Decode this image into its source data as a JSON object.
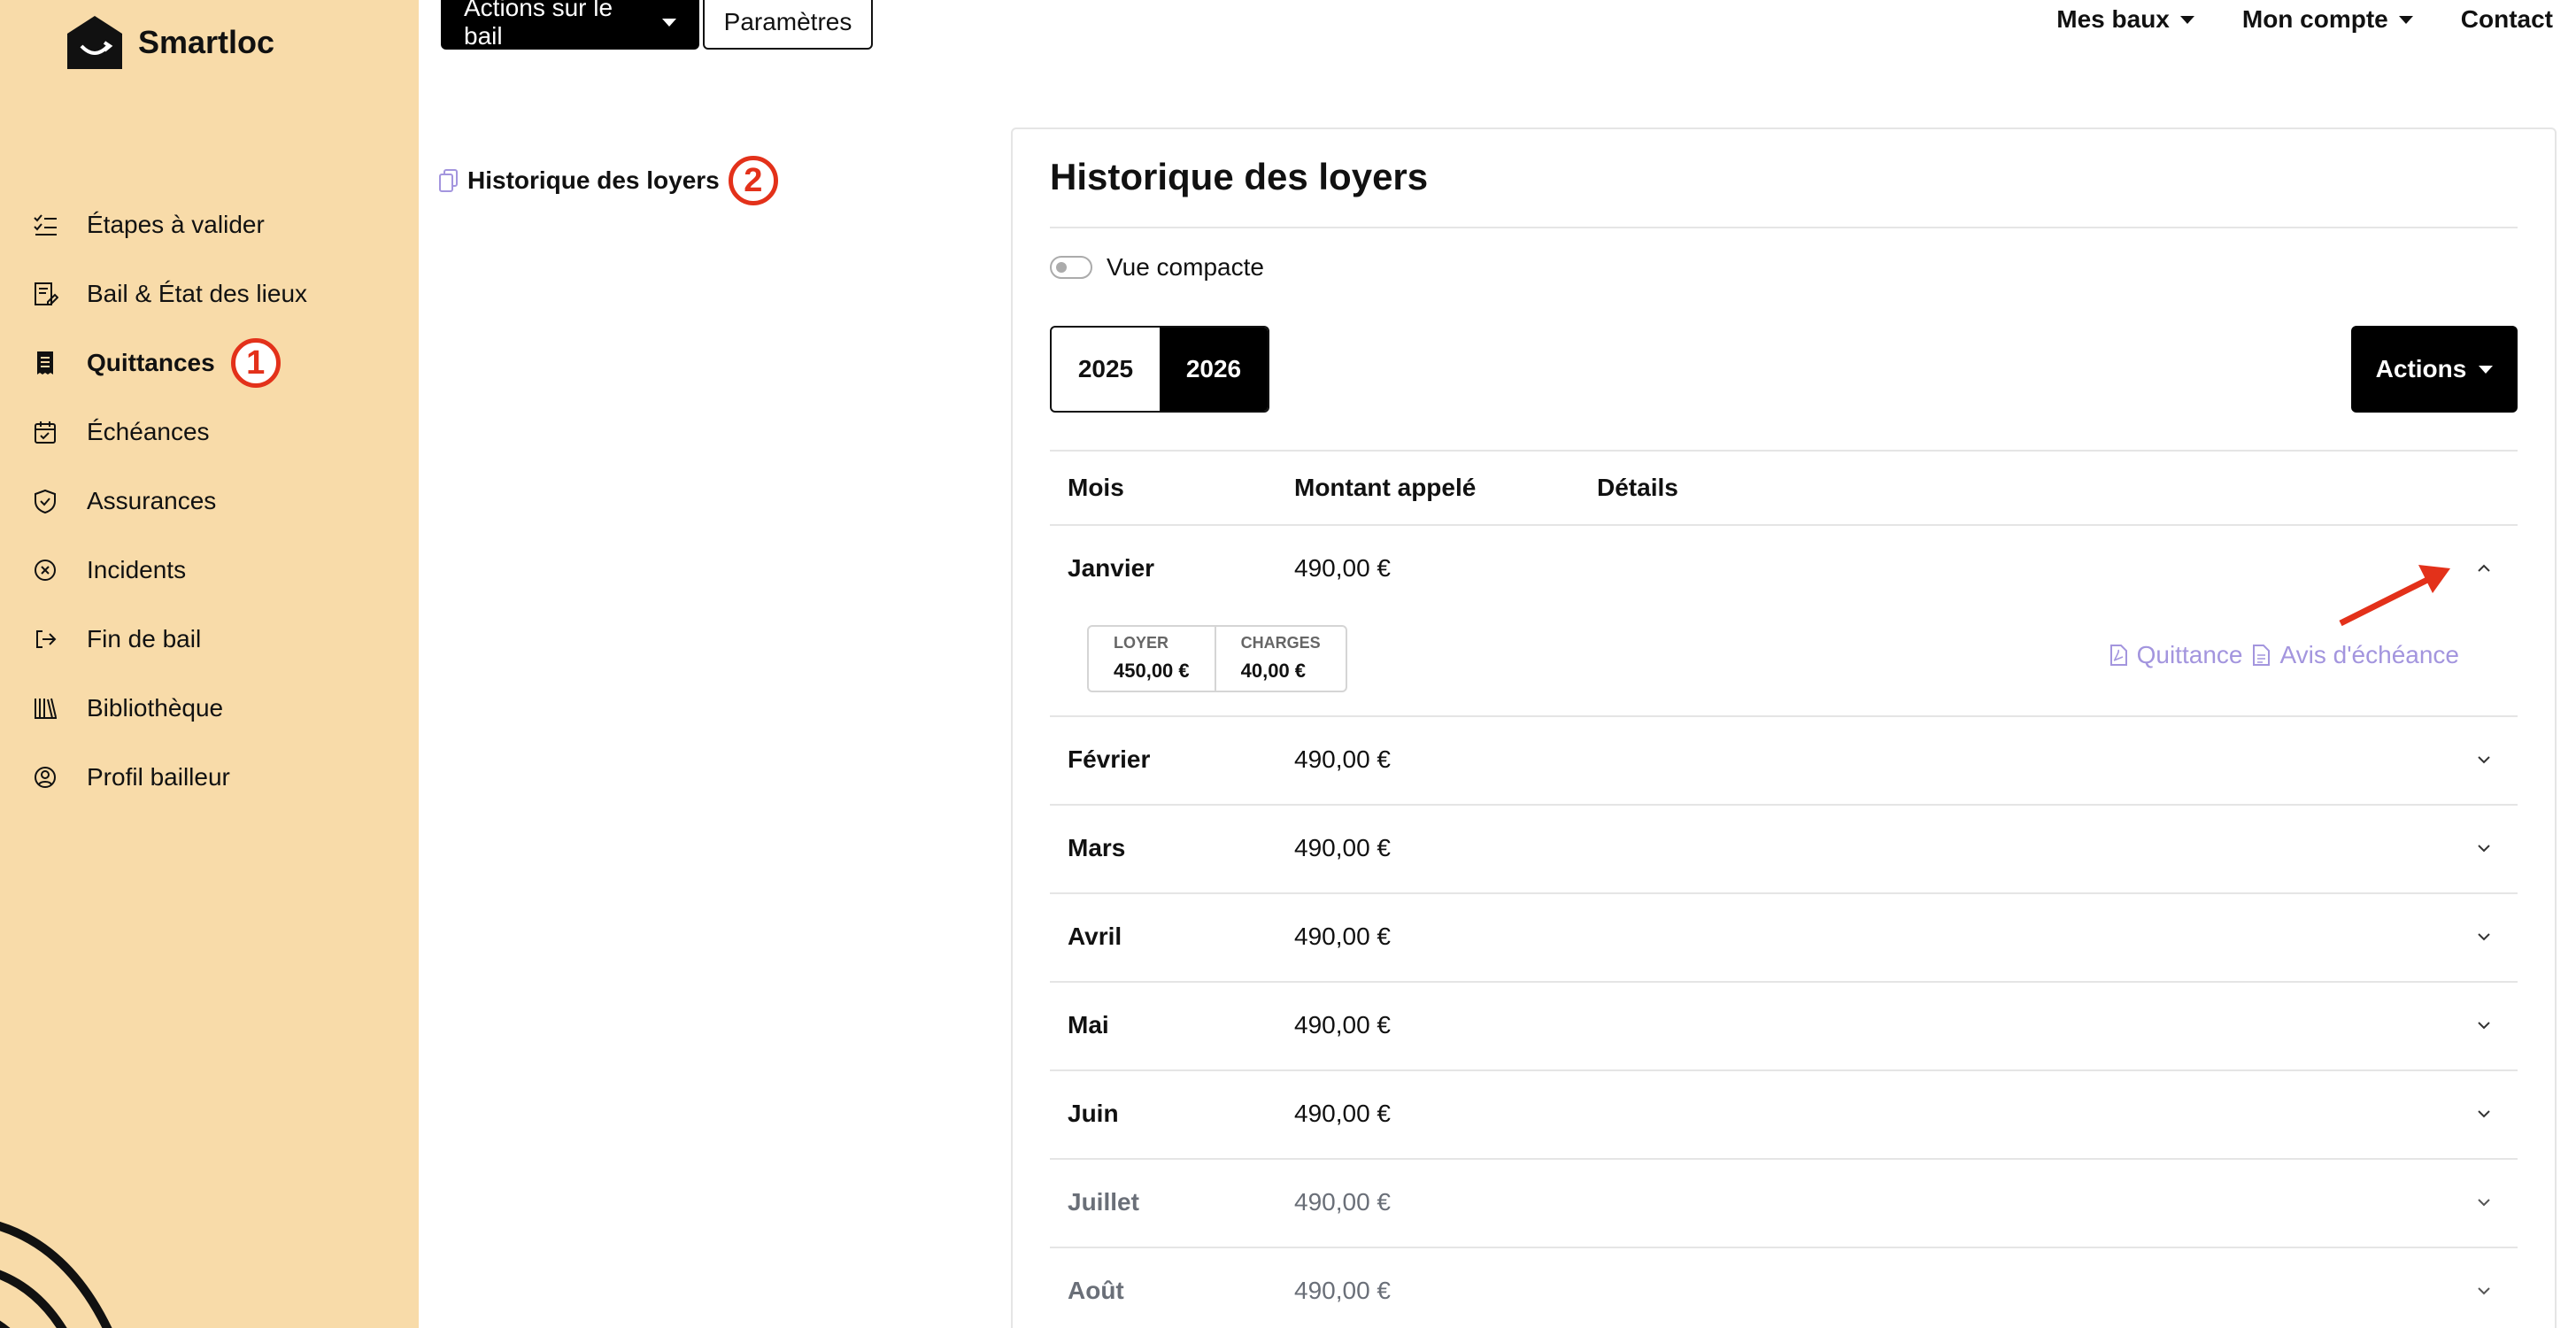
{
  "brand": {
    "name": "Smartloc"
  },
  "sidebar": {
    "items": [
      {
        "label": "Étapes à valider",
        "icon": "checklist-icon"
      },
      {
        "label": "Bail & État des lieux",
        "icon": "edit-document-icon"
      },
      {
        "label": "Quittances",
        "icon": "receipt-icon",
        "active": true
      },
      {
        "label": "Échéances",
        "icon": "calendar-check-icon"
      },
      {
        "label": "Assurances",
        "icon": "shield-icon"
      },
      {
        "label": "Incidents",
        "icon": "close-circle-icon"
      },
      {
        "label": "Fin de bail",
        "icon": "exit-icon"
      },
      {
        "label": "Bibliothèque",
        "icon": "library-icon"
      },
      {
        "label": "Profil bailleur",
        "icon": "user-circle-icon"
      }
    ],
    "badge": "1"
  },
  "topbar": {
    "actions_label": "Actions sur le bail",
    "settings_label": "Paramètres",
    "nav": [
      "Mes baux",
      "Mon compte",
      "Contact"
    ]
  },
  "page_link": {
    "label": "Historique des loyers",
    "badge": "2"
  },
  "card": {
    "title": "Historique des loyers",
    "compact_label": "Vue compacte",
    "years": [
      "2025",
      "2026"
    ],
    "active_year": "2026",
    "actions_label": "Actions",
    "columns": [
      "Mois",
      "Montant appelé",
      "Détails"
    ],
    "rows": [
      {
        "month": "Janvier",
        "amount": "490,00 €"
      },
      {
        "month": "Février",
        "amount": "490,00 €"
      },
      {
        "month": "Mars",
        "amount": "490,00 €"
      },
      {
        "month": "Avril",
        "amount": "490,00 €"
      },
      {
        "month": "Mai",
        "amount": "490,00 €"
      },
      {
        "month": "Juin",
        "amount": "490,00 €"
      },
      {
        "month": "Juillet",
        "amount": "490,00 €"
      },
      {
        "month": "Août",
        "amount": "490,00 €"
      }
    ],
    "expanded": {
      "loyer_label": "LOYER",
      "loyer_value": "450,00 €",
      "charges_label": "CHARGES",
      "charges_value": "40,00 €",
      "quittance_label": "Quittance",
      "avis_label": "Avis d'échéance"
    }
  },
  "colors": {
    "sidebar": "#f8dba9",
    "accent_red": "#e3311a",
    "link_purple": "#a395de"
  }
}
